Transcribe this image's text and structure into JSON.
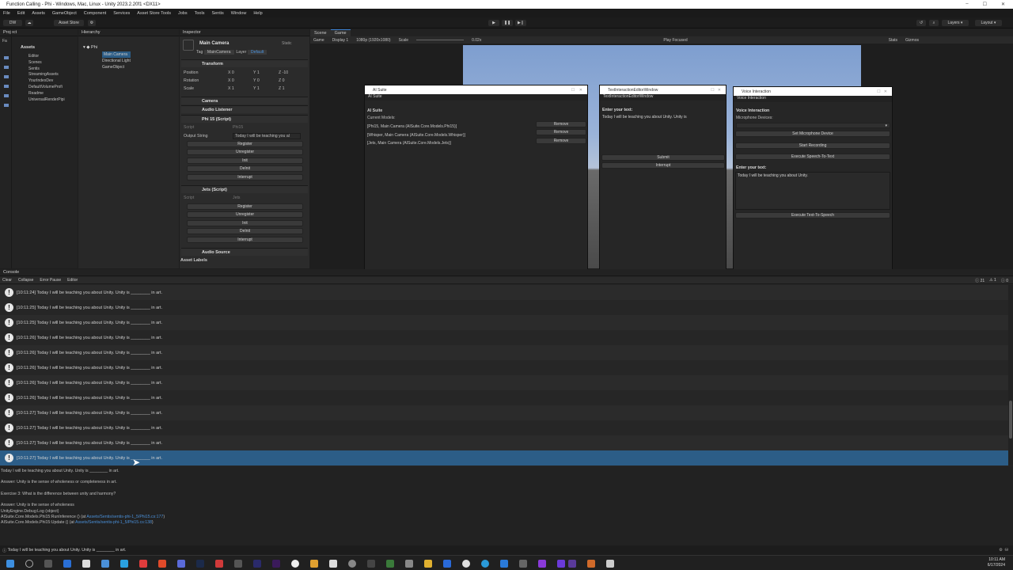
{
  "window": {
    "title": "Function Calling - Phi - Windows, Mac, Linux - Unity 2023.2.20f1 <DX11>",
    "controls": [
      "–",
      "☐",
      "✕"
    ]
  },
  "menu": [
    "File",
    "Edit",
    "Assets",
    "GameObject",
    "Component",
    "Services",
    "Asset Store Tools",
    "Jobs",
    "Tools",
    "Sentis",
    "Window",
    "Help"
  ],
  "toolbar": {
    "account": "DW",
    "asset_store": "Asset Store",
    "layers": "Layers",
    "layout": "Layout"
  },
  "project": {
    "tab": "Project",
    "root": "Assets",
    "favorites": "Fa",
    "items": [
      "Editor",
      "Scenes",
      "Sentis",
      "StreamingAssets",
      "YourIndexDev",
      "DefaultVolumeProfi",
      "Readme",
      "UniversalRenderPipi"
    ]
  },
  "hierarchy": {
    "tab": "Hierarchy",
    "scene": "Phi",
    "items": [
      "Main Camera",
      "Directional Light",
      "GameObject"
    ]
  },
  "inspector": {
    "tab": "Inspector",
    "object_name": "Main Camera",
    "static": "Static",
    "tag_label": "Tag",
    "tag_value": "MainCamera",
    "layer_label": "Layer",
    "layer_value": "Default",
    "transform": {
      "header": "Transform",
      "position_label": "Position",
      "rotation_label": "Rotation",
      "scale_label": "Scale",
      "px": "0",
      "py": "1",
      "pz": "-10",
      "rx": "0",
      "ry": "0",
      "rz": "0",
      "sx": "1",
      "sy": "1",
      "sz": "1",
      "x": "X",
      "y": "Y",
      "z": "Z"
    },
    "camera_header": "Camera",
    "audio_listener_header": "Audio Listener",
    "phi_header": "Phi 15 (Script)",
    "script_label": "Script",
    "phi_script": "Phi15",
    "output_label": "Output String",
    "output_value": "Today I will be teaching you al",
    "phi_buttons": [
      "Register",
      "Unregister",
      "Init",
      "DeInit",
      "Interrupt"
    ],
    "jets_header": "Jets (Script)",
    "jets_script": "Jets",
    "jets_buttons": [
      "Register",
      "Unregister",
      "Init",
      "DeInit",
      "Interrupt"
    ],
    "audio_source_header": "Audio Source",
    "asset_labels": "Asset Labels"
  },
  "scene_view": {
    "scene_tab": "Scene",
    "game_tab": "Game",
    "game_label": "Game",
    "display": "Display 1",
    "resolution": "1080p (1920x1080)",
    "scale_label": "Scale",
    "scale_value": "0.02x",
    "play_focused": "Play Focused",
    "stats": "Stats",
    "gizmos": "Gizmos"
  },
  "ai_suite": {
    "title": "AI Suite",
    "tab": "AI Suite",
    "heading": "AI Suite",
    "current_models": "Current Models:",
    "models": [
      "[Phi15, Main Camera (AISuite.Core.Models.Phi15)]",
      "[Whisper, Main Camera (AISuite.Core.Models.Whisper)]",
      "[Jets, Main Camera (AISuite.Core.Models.Jets)]"
    ],
    "remove": "Remove"
  },
  "text_window": {
    "title": "TextInteractionEditorWindow",
    "tab": "TextInteractionEditorWindow",
    "label": "Enter your text:",
    "value": "Today I will be teaching you about Unity. Unity is",
    "submit": "Submit",
    "interrupt": "Interrupt"
  },
  "voice_window": {
    "title": "Voice Interaction",
    "tab": "Voice Interaction",
    "heading": "Voice Interaction",
    "mic_label": "Microphone Devices:",
    "set_mic": "Set Microphone Device",
    "start_recording": "Start Recording",
    "stt": "Execute Speech-To-Text",
    "enter_label": "Enter your text:",
    "text_value": "Today I will be teaching you about Unity.",
    "tts": "Execute Text-To-Speech"
  },
  "console": {
    "tab": "Console",
    "clear": "Clear",
    "collapse": "Collapse",
    "error_pause": "Error Pause",
    "editor": "Editor",
    "count_info": "21",
    "count_warn": "1",
    "count_err": "0",
    "log_icon": "!",
    "entries": [
      "[10:11:24] Today I will be teaching you about Unity. Unity is ________ in art.",
      "[10:11:25] Today I will be teaching you about Unity. Unity is ________ in art.",
      "[10:11:25] Today I will be teaching you about Unity. Unity is ________ in art.",
      "[10:11:26] Today I will be teaching you about Unity. Unity is ________ in art.",
      "[10:11:26] Today I will be teaching you about Unity. Unity is ________ in art.",
      "[10:11:26] Today I will be teaching you about Unity. Unity is ________ in art.",
      "[10:11:26] Today I will be teaching you about Unity. Unity is ________ in art.",
      "[10:11:26] Today I will be teaching you about Unity. Unity is ________ in art.",
      "[10:11:27] Today I will be teaching you about Unity. Unity is ________ in art.",
      "[10:11:27] Today I will be teaching you about Unity. Unity is ________ in art.",
      "[10:11:27] Today I will be teaching you about Unity. Unity is ________ in art.",
      "[10:11:27] Today I will be teaching you about Unity. Unity is ________ in art."
    ],
    "detail": {
      "line1": "Today I will be teaching you about Unity. Unity is ________ in art.",
      "line2": "Answer: Unity is the sense of wholeness or completeness in art.",
      "line3": "Exercise 3: What is the difference between unity and harmony?",
      "line4": "Answer: Unity is the sense of wholeness",
      "line5": "UnityEngine.Debug:Log (object)",
      "line6a": "AISuite.Core.Models.Phi15:RunInference () (at ",
      "line6b": "Assets/Sentis/sentis-phi-1_5/Phi15.cs:177",
      "line7a": "AISuite.Core.Models.Phi15:Update () (at ",
      "line7b": "Assets/Sentis/sentis-phi-1_5/Phi15.cs:138"
    },
    "status": "Today I will be teaching you about Unity. Unity is ________ in art."
  },
  "taskbar": {
    "time": "10:11 AM",
    "date": "6/17/2024"
  }
}
